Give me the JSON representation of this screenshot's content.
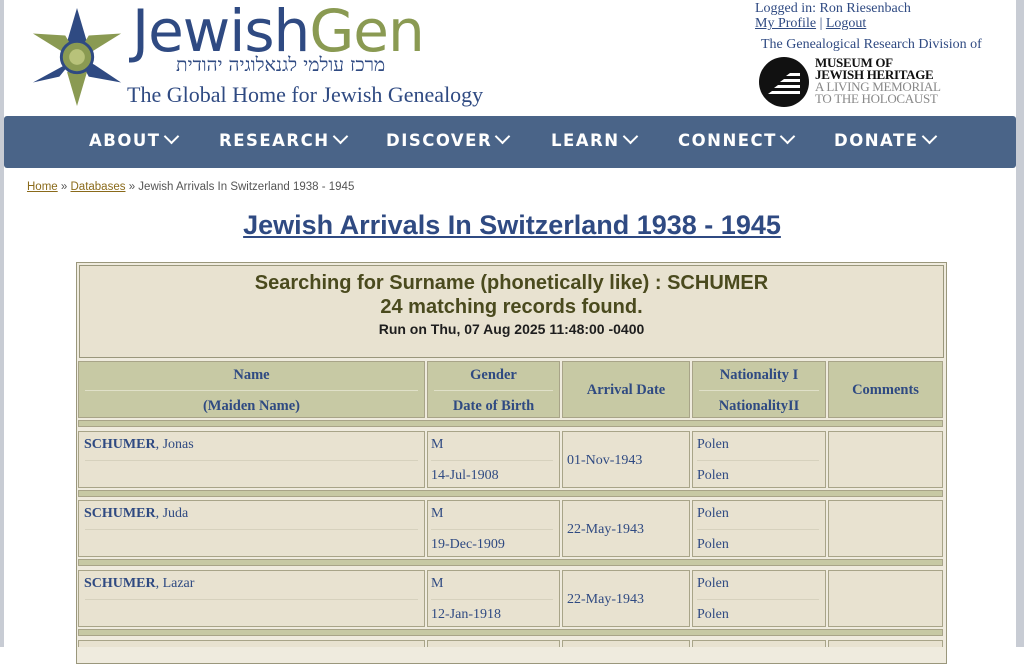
{
  "header": {
    "logo_main": "Jewish",
    "logo_gen": "Gen",
    "logo_hebrew": "מרכז עולמי לגנאלוגיה יהודית",
    "tagline": "The Global Home for Jewish Genealogy",
    "logged_in": "Logged in: Ron Riesenbach",
    "my_profile": "My Profile",
    "sep": "|",
    "logout": "Logout",
    "division": "The Genealogical Research Division of",
    "museum_line1": "MUSEUM OF",
    "museum_line2": "JEWISH HERITAGE",
    "museum_line3": "A LIVING MEMORIAL",
    "museum_line4": "TO THE HOLOCAUST"
  },
  "nav": {
    "items": [
      "ABOUT",
      "RESEARCH",
      "DISCOVER",
      "LEARN",
      "CONNECT",
      "DONATE"
    ]
  },
  "breadcrumb": {
    "home": "Home",
    "databases": "Databases",
    "sep": "»",
    "current": "Jewish Arrivals In Switzerland 1938 - 1945"
  },
  "page": {
    "title": "Jewish Arrivals In Switzerland 1938 - 1945"
  },
  "summary": {
    "search": "Searching for Surname (phonetically like) : SCHUMER",
    "count": "24 matching records found.",
    "run": "Run on Thu, 07 Aug 2025 11:48:00 -0400"
  },
  "table": {
    "headers": {
      "name": "Name",
      "maiden": "(Maiden Name)",
      "gender": "Gender",
      "dob": "Date of Birth",
      "arrival": "Arrival Date",
      "nat1": "Nationality I",
      "nat2": "NationalityII",
      "comments": "Comments"
    },
    "rows": [
      {
        "surname": "SCHUMER",
        "given": ", Jonas",
        "gender": "M",
        "dob": "14-Jul-1908",
        "arrival": "01-Nov-1943",
        "nat1": "Polen",
        "nat2": "Polen",
        "comments": ""
      },
      {
        "surname": "SCHUMER",
        "given": ", Juda",
        "gender": "M",
        "dob": "19-Dec-1909",
        "arrival": "22-May-1943",
        "nat1": "Polen",
        "nat2": "Polen",
        "comments": ""
      },
      {
        "surname": "SCHUMER",
        "given": ", Lazar",
        "gender": "M",
        "dob": "12-Jan-1918",
        "arrival": "22-May-1943",
        "nat1": "Polen",
        "nat2": "Polen",
        "comments": ""
      }
    ]
  },
  "colors": {
    "brand_blue": "#2f4a82",
    "brand_green": "#8a9a52",
    "nav_bg": "#4a6488",
    "header_cell": "#c7c9a4",
    "data_cell": "#e8e2d0"
  }
}
